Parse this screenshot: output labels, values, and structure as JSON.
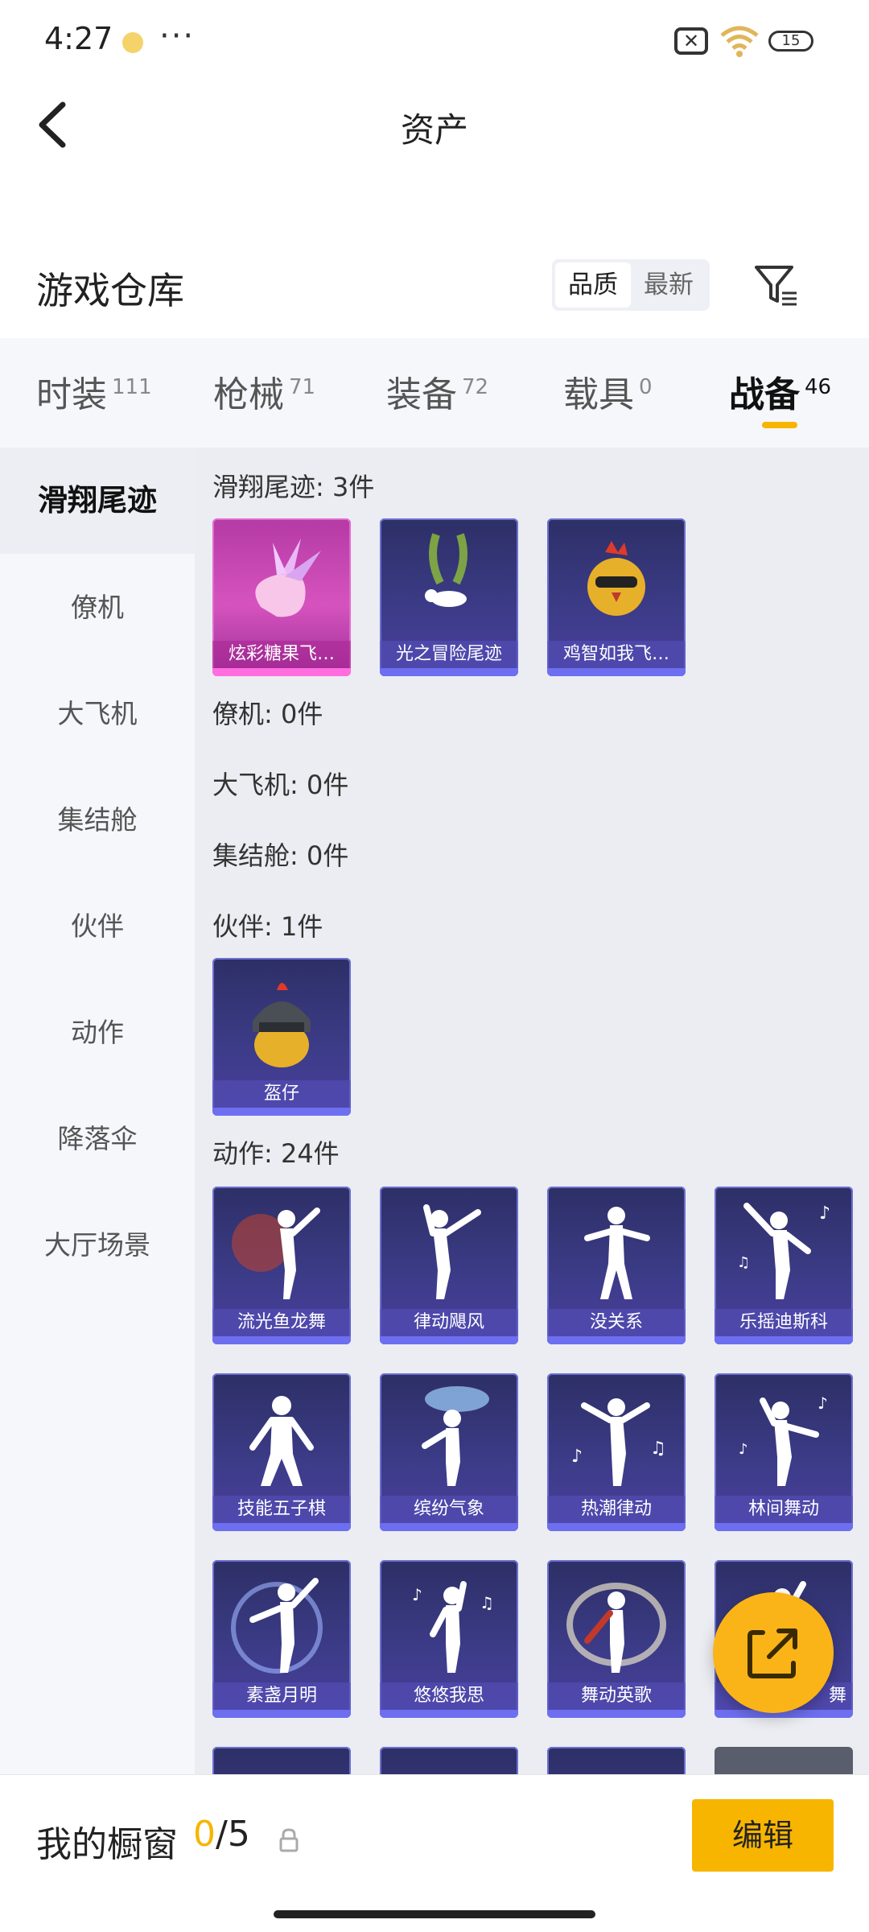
{
  "status_bar": {
    "time": "4:27",
    "battery": "15"
  },
  "header": {
    "title": "资产"
  },
  "warehouse": {
    "title": "游戏仓库",
    "sort_options": [
      "品质",
      "最新"
    ],
    "sort_active": "品质"
  },
  "tabs": [
    {
      "label": "时装",
      "count": "111"
    },
    {
      "label": "枪械",
      "count": "71"
    },
    {
      "label": "装备",
      "count": "72"
    },
    {
      "label": "载具",
      "count": "0"
    },
    {
      "label": "战备",
      "count": "46",
      "active": true
    }
  ],
  "sidebar": [
    {
      "label": "滑翔尾迹",
      "active": true
    },
    {
      "label": "僚机"
    },
    {
      "label": "大飞机"
    },
    {
      "label": "集结舱"
    },
    {
      "label": "伙伴"
    },
    {
      "label": "动作"
    },
    {
      "label": "降落伞"
    },
    {
      "label": "大厅场景"
    }
  ],
  "groups": [
    {
      "label": "滑翔尾迹: 3件",
      "items": [
        "炫彩糖果飞…",
        "光之冒险尾迹",
        "鸡智如我飞…"
      ]
    },
    {
      "label": "僚机: 0件",
      "items": []
    },
    {
      "label": "大飞机: 0件",
      "items": []
    },
    {
      "label": "集结舱: 0件",
      "items": []
    },
    {
      "label": "伙伴: 1件",
      "items": [
        "盔仔"
      ]
    },
    {
      "label": "动作: 24件",
      "items": [
        "流光鱼龙舞",
        "律动飓风",
        "没关系",
        "乐摇迪斯科",
        "技能五子棋",
        "缤纷气象",
        "热潮律动",
        "林间舞动",
        "素盏月明",
        "悠悠我思",
        "舞动英歌",
        "舞"
      ]
    }
  ],
  "bottom": {
    "showcase_label": "我的橱窗",
    "showcase_current": "0",
    "showcase_total": "/5",
    "edit_label": "编辑"
  },
  "colors": {
    "accent": "#f7b500",
    "card_bg": "#3d3c8a",
    "card_pink": "#d653be",
    "fab": "#fbb417"
  },
  "icons": [
    "back-arrow-icon",
    "filter-icon",
    "share-icon",
    "lock-icon",
    "wifi-icon",
    "battery-icon"
  ]
}
